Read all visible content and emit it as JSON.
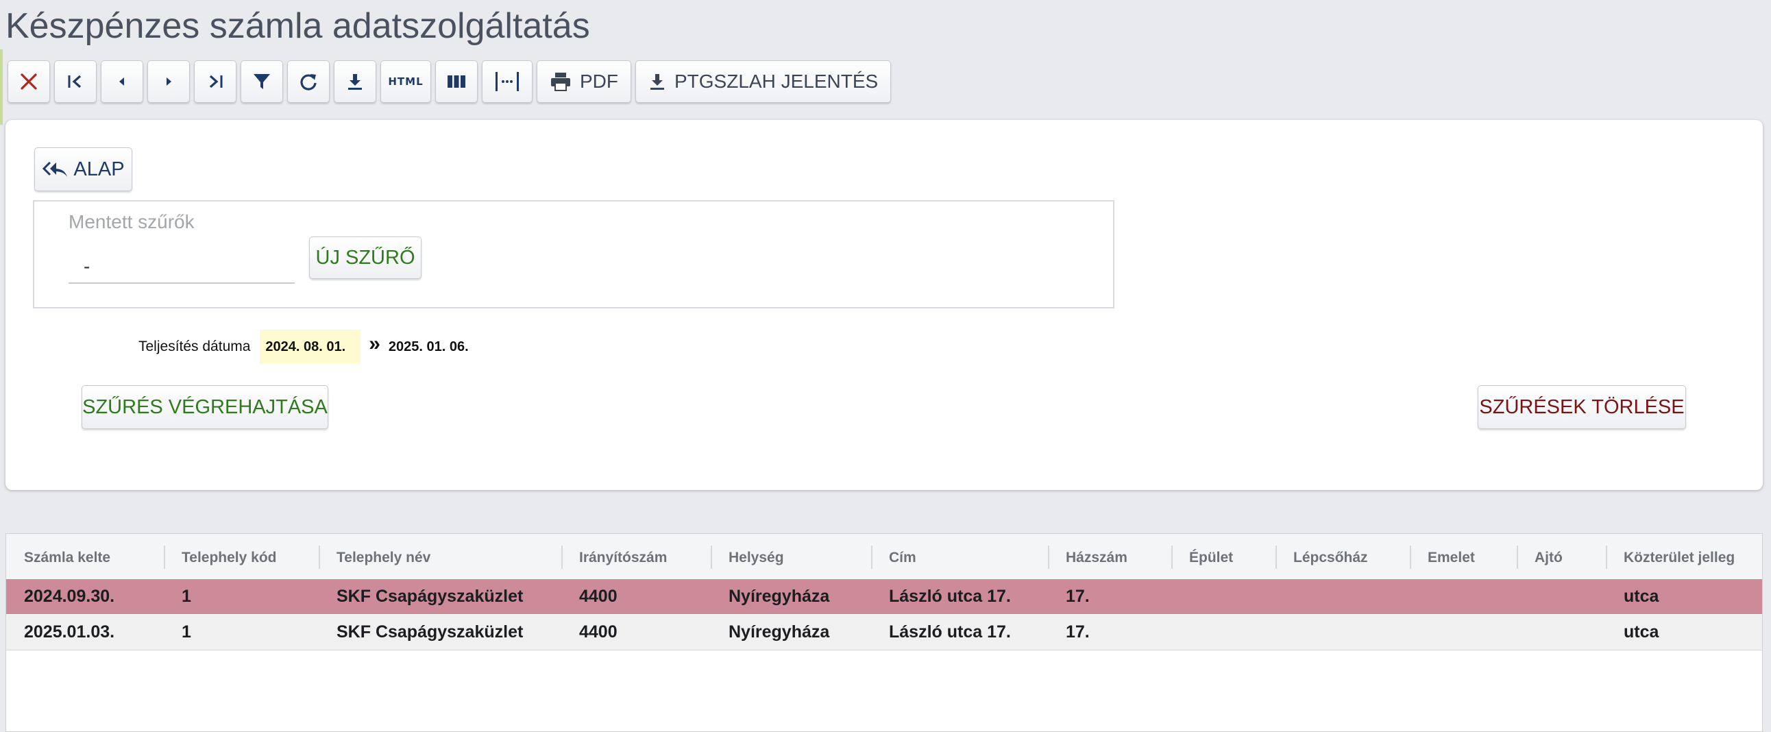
{
  "page": {
    "title": "Készpénzes számla adatszolgáltatás"
  },
  "toolbar": {
    "pdf_label": "PDF",
    "ptgszlah_label": "PTGSZLAH JELENTÉS",
    "html_label": "HTML"
  },
  "filters": {
    "alap_label": "ALAP",
    "saved_label": "Mentett szűrők",
    "saved_value": "-",
    "new_filter_label": "ÚJ SZŰRŐ",
    "date_label": "Teljesítés dátuma",
    "date_from": "2024. 08. 01.",
    "date_separator": "»",
    "date_to": "2025. 01. 06.",
    "execute_label": "SZŰRÉS VÉGREHAJTÁSA",
    "clear_label": "SZŰRÉSEK TÖRLÉSE"
  },
  "table": {
    "columns": [
      "Számla kelte",
      "Telephely kód",
      "Telephely név",
      "Irányítószám",
      "Helység",
      "Cím",
      "Házszám",
      "Épület",
      "Lépcsőház",
      "Emelet",
      "Ajtó",
      "Közterület jelleg"
    ],
    "rows": [
      [
        "2024.09.30.",
        "1",
        "SKF Csapágyszaküzlet",
        "4400",
        "Nyíregyháza",
        "László utca 17.",
        "17.",
        "",
        "",
        "",
        "",
        "utca"
      ],
      [
        "2025.01.03.",
        "1",
        "SKF Csapágyszaküzlet",
        "4400",
        "Nyíregyháza",
        "László utca 17.",
        "17.",
        "",
        "",
        "",
        "",
        "utca"
      ]
    ],
    "selected_row_color": "#cd8a99"
  },
  "colors": {
    "accent_navy": "#1f3a66",
    "green": "#2f7a1c",
    "dark_red": "#7a1414"
  }
}
